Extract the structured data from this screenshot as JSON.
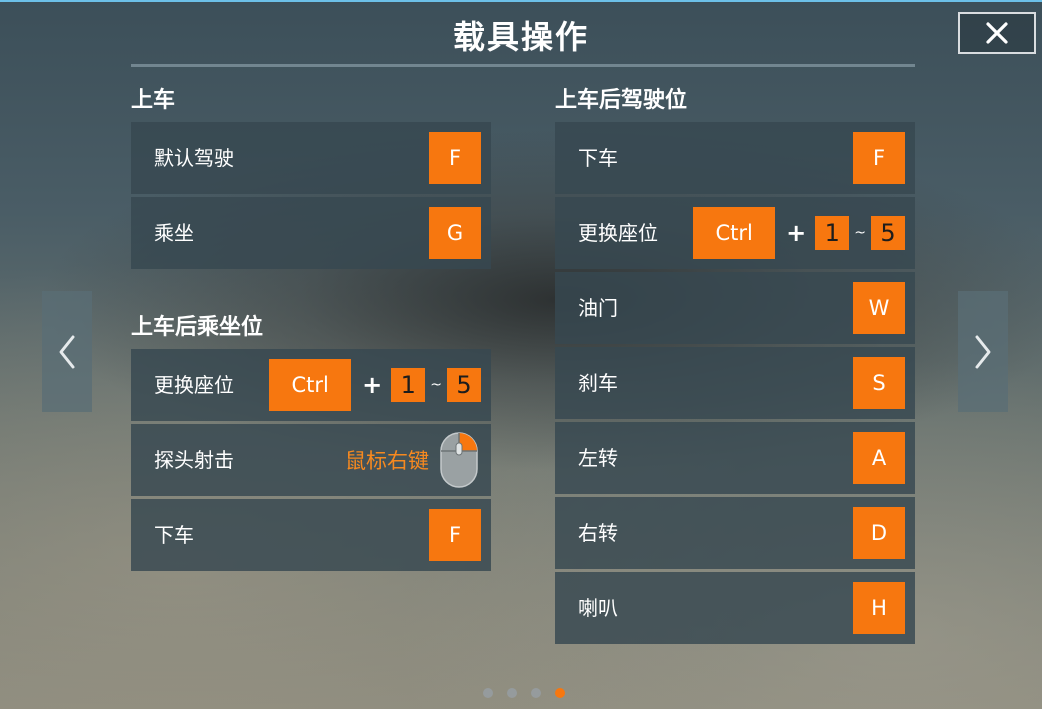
{
  "title": "载具操作",
  "colors": {
    "accent": "#f7770f",
    "panel": "#374850"
  },
  "icons": {
    "close": "close-icon",
    "prev": "chevron-left-icon",
    "next": "chevron-right-icon",
    "mouse": "mouse-right-click-icon"
  },
  "left": {
    "section1": {
      "title": "上车",
      "rows": [
        {
          "label": "默认驾驶",
          "key": "F"
        },
        {
          "label": "乘坐",
          "key": "G"
        }
      ]
    },
    "section2": {
      "title": "上车后乘坐位",
      "switch_seat": {
        "label": "更换座位",
        "key": "Ctrl",
        "plus": "+",
        "from": "1",
        "tilde": "~",
        "to": "5"
      },
      "peek": {
        "label": "探头射击",
        "mouse_text": "鼠标右键"
      },
      "exit": {
        "label": "下车",
        "key": "F"
      }
    }
  },
  "right": {
    "title": "上车后驾驶位",
    "exit": {
      "label": "下车",
      "key": "F"
    },
    "switch_seat": {
      "label": "更换座位",
      "key": "Ctrl",
      "plus": "+",
      "from": "1",
      "tilde": "~",
      "to": "5"
    },
    "rows": [
      {
        "label": "油门",
        "key": "W"
      },
      {
        "label": "刹车",
        "key": "S"
      },
      {
        "label": "左转",
        "key": "A"
      },
      {
        "label": "右转",
        "key": "D"
      },
      {
        "label": "喇叭",
        "key": "H"
      }
    ]
  },
  "pagination": {
    "total": 4,
    "current": 4
  }
}
